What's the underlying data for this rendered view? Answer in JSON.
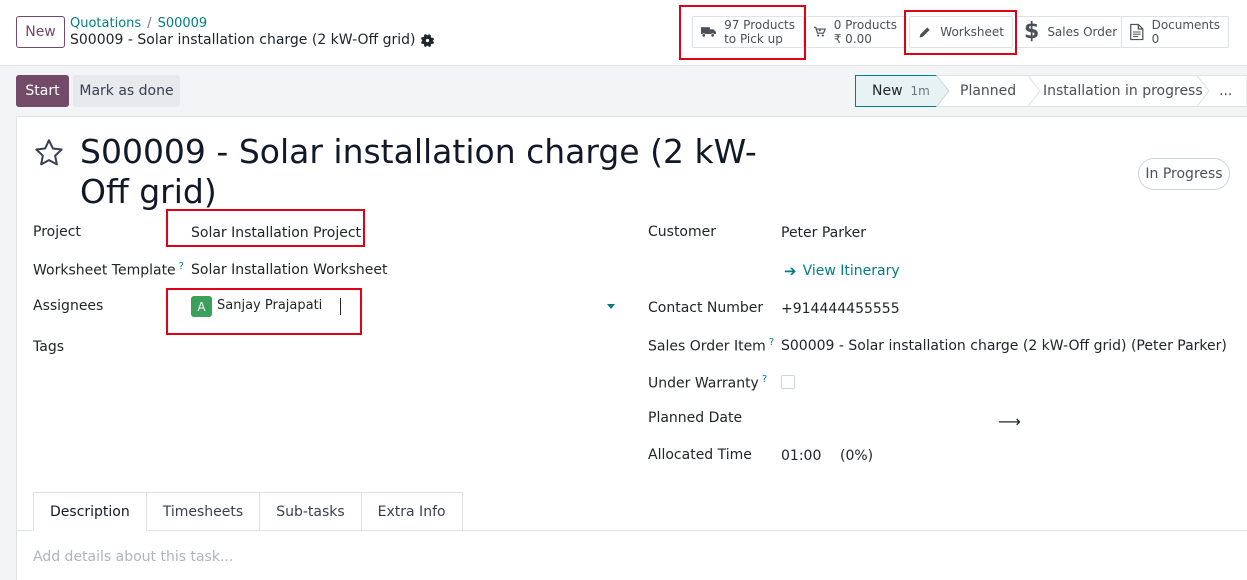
{
  "topbar": {
    "new_label": "New",
    "breadcrumb": [
      "Quotations",
      "S00009"
    ],
    "record_title": "S00009 - Solar installation charge (2 kW-Off grid)"
  },
  "stat_buttons": {
    "pickup": {
      "line1": "97 Products",
      "line2": "to Pick up",
      "icon": "truck-icon"
    },
    "products": {
      "line1": "0 Products",
      "line2": "₹ 0.00",
      "icon": "cart-icon"
    },
    "worksheet": {
      "label": "Worksheet",
      "icon": "pencil-icon"
    },
    "sales_order": {
      "label": "Sales Order",
      "icon": "dollar-icon"
    },
    "documents": {
      "line1": "Documents",
      "line2": "0",
      "icon": "document-icon"
    }
  },
  "actions": {
    "start_label": "Start",
    "done_label": "Mark as done"
  },
  "stages": {
    "current": "New",
    "current_badge": "1m",
    "items": [
      "Planned",
      "Installation in progress",
      "..."
    ]
  },
  "task": {
    "title": "S00009 - Solar installation charge (2 kW-Off grid)",
    "status": "In Progress"
  },
  "fields": {
    "project_label": "Project",
    "project_value": "Solar Installation Project",
    "worksheet_template_label": "Worksheet Template",
    "worksheet_template_value": "Solar Installation Worksheet",
    "assignees_label": "Assignees",
    "assignee_initial": "A",
    "assignee_name": "Sanjay Prajapati",
    "tags_label": "Tags",
    "customer_label": "Customer",
    "customer_value": "Peter Parker",
    "view_itinerary": "View Itinerary",
    "contact_label": "Contact Number",
    "contact_value": "+914444455555",
    "sales_order_item_label": "Sales Order Item",
    "sales_order_item_value": "S00009 - Solar installation charge (2 kW-Off grid) (Peter Parker)",
    "warranty_label": "Under Warranty",
    "planned_date_label": "Planned Date",
    "allocated_time_label": "Allocated Time",
    "allocated_time_value": "01:00",
    "allocated_pct": "(0%)",
    "help_mark": "?"
  },
  "tabs": [
    "Description",
    "Timesheets",
    "Sub-tasks",
    "Extra Info"
  ],
  "description_placeholder": "Add details about this task...",
  "colors": {
    "primary": "#714b67",
    "accent": "#017e84",
    "highlight": "#e1001a"
  }
}
